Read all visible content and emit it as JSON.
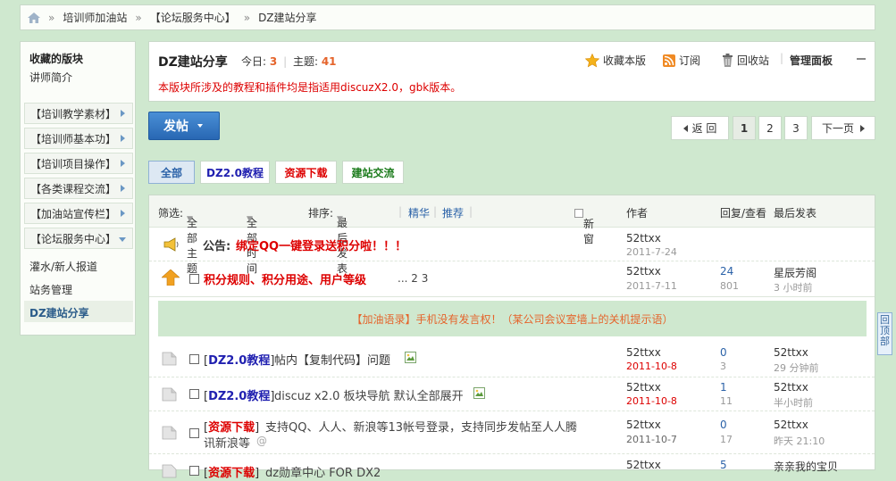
{
  "breadcrumb": {
    "items": [
      "培训师加油站",
      "【论坛服务中心】",
      "DZ建站分享"
    ],
    "sep": "»"
  },
  "sidebar": {
    "heading": "收藏的版块",
    "fav_item": "讲师简介",
    "categories": [
      "【培训教学素材】",
      "【培训师基本功】",
      "【培训项目操作】",
      "【各类课程交流】",
      "【加油站宣传栏】",
      "【论坛服务中心】"
    ],
    "sub_items": [
      "灌水/新人报道",
      "站务管理",
      "DZ建站分享"
    ]
  },
  "forum": {
    "title": "DZ建站分享",
    "today_label": "今日:",
    "today": "3",
    "topics_label": "主题:",
    "topics": "41",
    "notice": "本版块所涉及的教程和插件均是指适用discuzX2.0，gbk版本。",
    "fav": "收藏本版",
    "subscribe": "订阅",
    "recycle": "回收站",
    "manage": "管理面板"
  },
  "post_button": "发帖",
  "pager": {
    "back": "返 回",
    "pages": [
      "1",
      "2",
      "3"
    ],
    "next": "下一页"
  },
  "tabs": [
    "全部",
    "DZ2.0教程",
    "资源下载",
    "建站交流"
  ],
  "filter": {
    "label": "筛选:",
    "all_topics": "全部主题",
    "all_time": "全部时间",
    "sort": "排序:",
    "last_post": "最后发表",
    "digest": "精华",
    "recommend": "推荐",
    "new_window": "新窗",
    "col_author": "作者",
    "col_reply": "回复/查看",
    "col_last": "最后发表"
  },
  "announce": {
    "prefix": "公告:",
    "title": "绑定QQ一键登录送积分啦！！！",
    "author": "52ttxx",
    "date": "2011-7-24"
  },
  "sticky": {
    "title": "积分规则、积分用途、用户等级",
    "pages": "... 2  3",
    "author": "52ttxx",
    "date": "2011-7-11",
    "replies": "24",
    "views": "801",
    "last_user": "星辰芳阁",
    "last_time": "3 小时前"
  },
  "banner": "【加油语录】手机没有发言权！（某公司会议室墙上的关机提示语）",
  "threads": [
    {
      "type": "DZ2.0教程",
      "title": "帖内【复制代码】问题",
      "author": "52ttxx",
      "date": "2011-10-8",
      "replies": "0",
      "views": "3",
      "last_user": "52ttxx",
      "last_time": "29 分钟前"
    },
    {
      "type": "DZ2.0教程",
      "title": "discuz x2.0 板块导航 默认全部展开",
      "author": "52ttxx",
      "date": "2011-10-8",
      "replies": "1",
      "views": "11",
      "last_user": "52ttxx",
      "last_time": "半小时前"
    },
    {
      "type": "资源下载",
      "title": "支持QQ、人人、新浪等13帐号登录，支持同步发帖至人人腾",
      "title2": "讯新浪等",
      "author": "52ttxx",
      "date": "2011-10-7",
      "replies": "0",
      "views": "17",
      "last_user": "52ttxx",
      "last_time": "昨天 21:10"
    },
    {
      "type": "资源下载",
      "title": "dz勋章中心 FOR DX2",
      "author": "52ttxx",
      "date": "",
      "replies": "5",
      "views": "",
      "last_user": "亲亲我的宝贝",
      "last_time": ""
    }
  ],
  "back_top": "回顶部",
  "colors": {
    "bg": "#cfe8cf",
    "accent": "#e5642b",
    "link": "#2b62a8",
    "red": "#dd0000"
  }
}
